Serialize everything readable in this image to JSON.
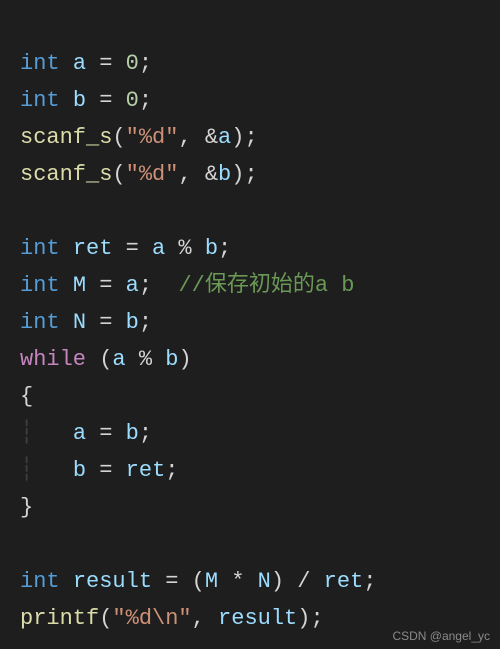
{
  "code": {
    "l1": {
      "kw": "int",
      "v": "a",
      "eq": " = ",
      "n": "0",
      "sc": ";"
    },
    "l2": {
      "kw": "int",
      "v": "b",
      "eq": " = ",
      "n": "0",
      "sc": ";"
    },
    "l3": {
      "fn": "scanf_s",
      "op1": "(",
      "s": "\"%d\"",
      "op2": ", &",
      "v": "a",
      "op3": ");"
    },
    "l4": {
      "fn": "scanf_s",
      "op1": "(",
      "s": "\"%d\"",
      "op2": ", &",
      "v": "b",
      "op3": ");"
    },
    "blank1": "",
    "l5": {
      "kw": "int",
      "v": "ret",
      "eq": " = ",
      "a": "a",
      "op": " % ",
      "b": "b",
      "sc": ";"
    },
    "l6": {
      "kw": "int",
      "v": "M",
      "eq": " = ",
      "a": "a",
      "sc": ";",
      "sp": "  ",
      "cmt": "//保存初始的a b"
    },
    "l7": {
      "kw": "int",
      "v": "N",
      "eq": " = ",
      "b": "b",
      "sc": ";"
    },
    "l8": {
      "kw": "while",
      "op1": " (",
      "a": "a",
      "op": " % ",
      "b": "b",
      "op2": ")"
    },
    "l9": {
      "brace": "{"
    },
    "l10": {
      "guide": "┆   ",
      "a": "a",
      "eq": " = ",
      "b": "b",
      "sc": ";"
    },
    "l11": {
      "guide": "┆   ",
      "b": "b",
      "eq": " = ",
      "r": "ret",
      "sc": ";"
    },
    "l12": {
      "brace": "}"
    },
    "blank2": "",
    "l13": {
      "kw": "int",
      "v": "result",
      "eq": " = (",
      "m": "M",
      "op1": " * ",
      "n": "N",
      "op2": ") / ",
      "r": "ret",
      "sc": ";"
    },
    "l14": {
      "fn": "printf",
      "op1": "(",
      "s": "\"%d\\n\"",
      "op2": ", ",
      "v": "result",
      "op3": ");"
    }
  },
  "watermark": "CSDN @angel_yc"
}
